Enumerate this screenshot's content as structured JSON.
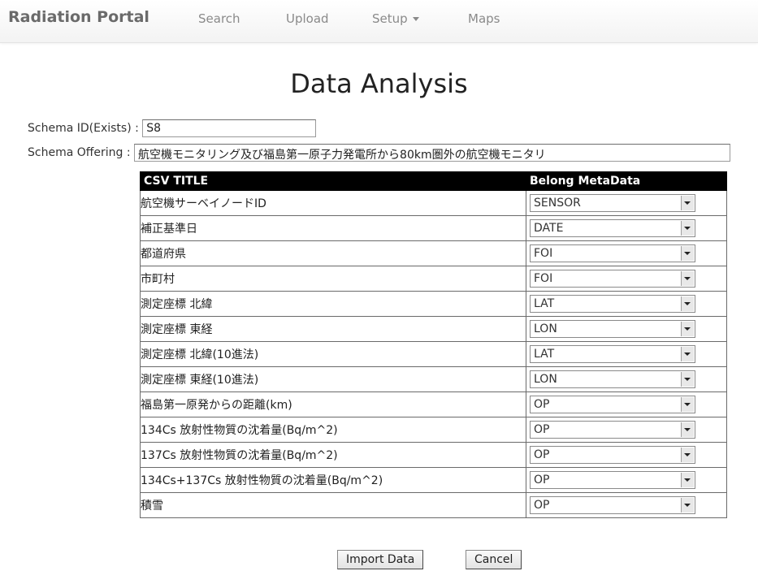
{
  "navbar": {
    "brand": "Radiation Portal",
    "items": [
      {
        "label": "Search"
      },
      {
        "label": "Upload"
      },
      {
        "label": "Setup"
      },
      {
        "label": "Maps"
      }
    ]
  },
  "page": {
    "title": "Data Analysis"
  },
  "form": {
    "schema_id_label": "Schema ID(Exists) :",
    "schema_id_value": "S8",
    "schema_offering_label": "Schema Offering :",
    "schema_offering_value": "航空機モニタリング及び福島第一原子力発電所から80km圏外の航空機モニタリ"
  },
  "table": {
    "headers": {
      "csv_title": "CSV TITLE",
      "belong_metadata": "Belong MetaData"
    },
    "rows": [
      {
        "title": "航空機サーベイノードID",
        "meta": "SENSOR"
      },
      {
        "title": "補正基準日",
        "meta": "DATE"
      },
      {
        "title": "都道府県",
        "meta": "FOI"
      },
      {
        "title": "市町村",
        "meta": "FOI"
      },
      {
        "title": "測定座標 北緯",
        "meta": "LAT"
      },
      {
        "title": "測定座標 東経",
        "meta": "LON"
      },
      {
        "title": "測定座標 北緯(10進法)",
        "meta": "LAT"
      },
      {
        "title": "測定座標 東経(10進法)",
        "meta": "LON"
      },
      {
        "title": "福島第一原発からの距離(km)",
        "meta": "OP"
      },
      {
        "title": "134Cs 放射性物質の沈着量(Bq/m^2)",
        "meta": "OP"
      },
      {
        "title": "137Cs 放射性物質の沈着量(Bq/m^2)",
        "meta": "OP"
      },
      {
        "title": "134Cs+137Cs 放射性物質の沈着量(Bq/m^2)",
        "meta": "OP"
      },
      {
        "title": "積雪",
        "meta": "OP"
      }
    ]
  },
  "buttons": {
    "import": "Import Data",
    "cancel": "Cancel"
  }
}
